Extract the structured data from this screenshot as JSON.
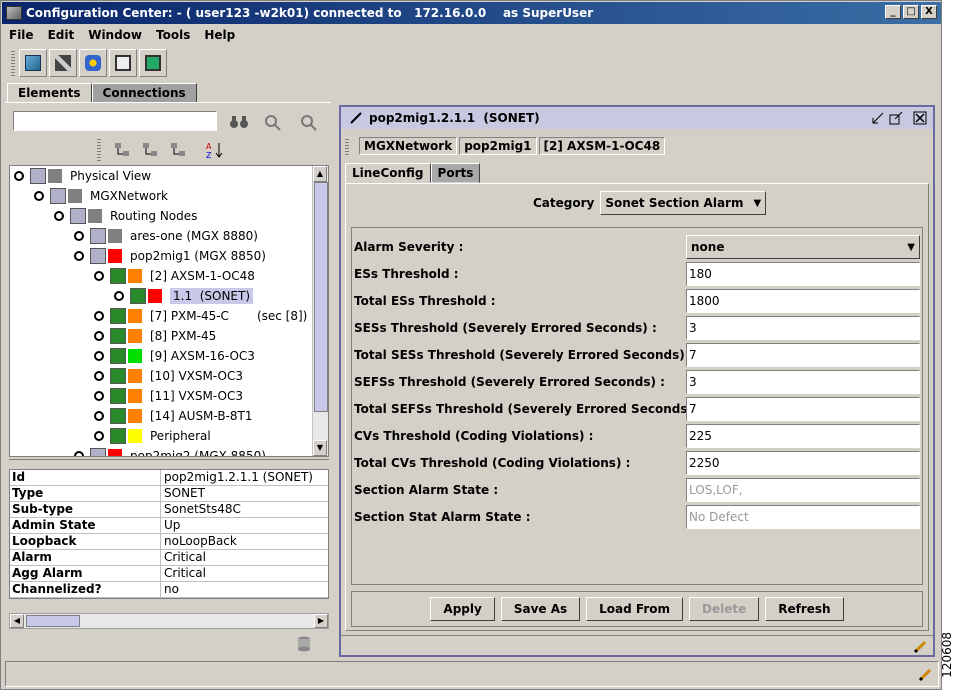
{
  "window": {
    "title": "Configuration Center: - ( user123 -w2k01) connected to   172.16.0.0    as SuperUser",
    "min": "_",
    "max": "□",
    "close": "X"
  },
  "menu": [
    "File",
    "Edit",
    "Window",
    "Tools",
    "Help"
  ],
  "top_tabs": {
    "elements": "Elements",
    "connections": "Connections"
  },
  "tree": [
    {
      "label": "Physical View",
      "indent": 0,
      "color": "#808080"
    },
    {
      "label": "MGXNetwork",
      "indent": 1,
      "color": "#808080"
    },
    {
      "label": "Routing Nodes",
      "indent": 2,
      "color": "#808080"
    },
    {
      "label": "ares-one (MGX 8880)",
      "indent": 3,
      "color": "#808080"
    },
    {
      "label": "pop2mig1 (MGX 8850)",
      "indent": 3,
      "color": "#ff0000"
    },
    {
      "label": "[2] AXSM-1-OC48",
      "indent": 4,
      "color": "#ff8000"
    },
    {
      "label": "1.1  (SONET)",
      "indent": 5,
      "color": "#ff0000",
      "selected": true
    },
    {
      "label": "[7] PXM-45-C",
      "indent": 4,
      "color": "#ff8000",
      "extra": "(sec [8])"
    },
    {
      "label": "[8] PXM-45",
      "indent": 4,
      "color": "#ff8000"
    },
    {
      "label": "[9] AXSM-16-OC3",
      "indent": 4,
      "color": "#00e000"
    },
    {
      "label": "[10] VXSM-OC3",
      "indent": 4,
      "color": "#ff8000"
    },
    {
      "label": "[11] VXSM-OC3",
      "indent": 4,
      "color": "#ff8000"
    },
    {
      "label": "[14] AUSM-B-8T1",
      "indent": 4,
      "color": "#ff8000"
    },
    {
      "label": "Peripheral",
      "indent": 4,
      "color": "#ffff00"
    },
    {
      "label": "pop2mig2 (MGX 8850)",
      "indent": 3,
      "color": "#ff0000"
    }
  ],
  "properties": [
    {
      "k": "Id",
      "v": "pop2mig1.2.1.1  (SONET)"
    },
    {
      "k": "Type",
      "v": "SONET"
    },
    {
      "k": "Sub-type",
      "v": "SonetSts48C"
    },
    {
      "k": "Admin State",
      "v": "Up"
    },
    {
      "k": "Loopback",
      "v": "noLoopBack"
    },
    {
      "k": "Alarm",
      "v": "Critical"
    },
    {
      "k": "Agg Alarm",
      "v": "Critical"
    },
    {
      "k": "Channelized?",
      "v": "no"
    }
  ],
  "detail": {
    "title": "pop2mig1.2.1.1  (SONET)",
    "crumbs": [
      "MGXNetwork",
      "pop2mig1",
      "[2] AXSM-1-OC48"
    ],
    "tabs": {
      "lineconfig": "LineConfig",
      "ports": "Ports"
    },
    "category_label": "Category",
    "category_value": "Sonet Section Alarm",
    "fields": [
      {
        "label": "Alarm Severity :",
        "value": "none",
        "kind": "select"
      },
      {
        "label": "ESs Threshold :",
        "value": "180"
      },
      {
        "label": "Total ESs Threshold :",
        "value": "1800"
      },
      {
        "label": "SESs Threshold (Severely Errored Seconds) :",
        "value": "3"
      },
      {
        "label": "Total SESs Threshold (Severely Errored Seconds) :",
        "value": "7"
      },
      {
        "label": "SEFSs Threshold (Severely Errored Seconds) :",
        "value": "3"
      },
      {
        "label": "Total SEFSs Threshold (Severely Errored Seconds) :",
        "value": "7"
      },
      {
        "label": "CVs Threshold (Coding Violations) :",
        "value": "225"
      },
      {
        "label": "Total CVs Threshold (Coding Violations) :",
        "value": "2250"
      },
      {
        "label": "Section Alarm State :",
        "value": "LOS,LOF,",
        "kind": "ro"
      },
      {
        "label": "Section Stat Alarm State :",
        "value": "No Defect",
        "kind": "ro"
      }
    ],
    "buttons": {
      "apply": "Apply",
      "saveas": "Save As",
      "loadfrom": "Load From",
      "delete": "Delete",
      "refresh": "Refresh"
    }
  },
  "figure_id": "120608"
}
